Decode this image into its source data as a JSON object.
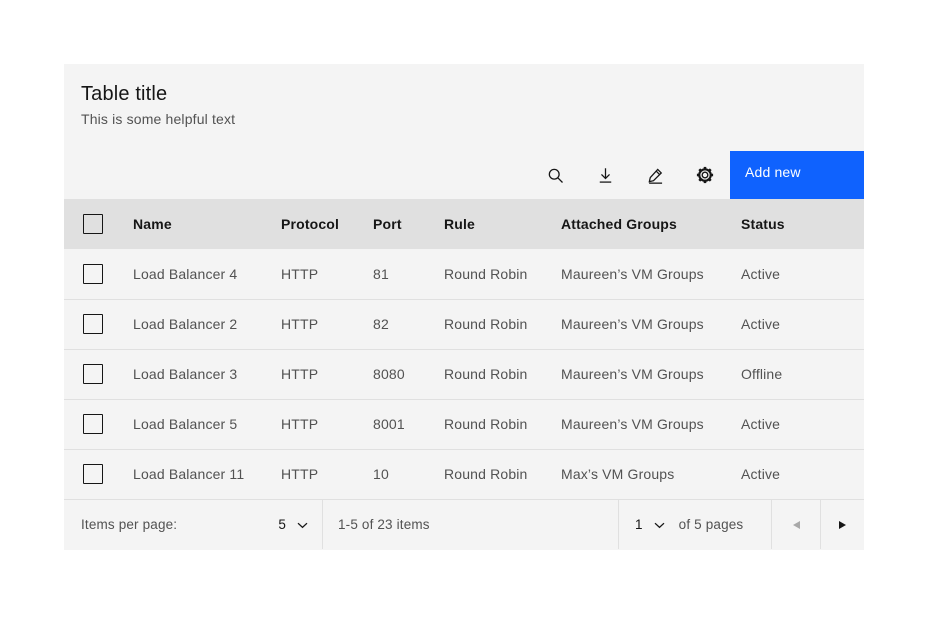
{
  "table": {
    "title": "Table title",
    "helper": "This is some helpful text",
    "toolbar": {
      "icons": [
        "search",
        "download",
        "edit",
        "settings"
      ],
      "add_label": "Add new"
    },
    "columns": [
      "Name",
      "Protocol",
      "Port",
      "Rule",
      "Attached Groups",
      "Status"
    ],
    "rows": [
      {
        "name": "Load Balancer 4",
        "protocol": "HTTP",
        "port": "81",
        "rule": "Round Robin",
        "attached_groups": "Maureen’s VM Groups",
        "status": "Active"
      },
      {
        "name": "Load Balancer 2",
        "protocol": "HTTP",
        "port": "82",
        "rule": "Round Robin",
        "attached_groups": "Maureen’s VM Groups",
        "status": "Active"
      },
      {
        "name": "Load Balancer 3",
        "protocol": "HTTP",
        "port": "8080",
        "rule": "Round Robin",
        "attached_groups": "Maureen’s VM Groups",
        "status": "Offline"
      },
      {
        "name": "Load Balancer 5",
        "protocol": "HTTP",
        "port": "8001",
        "rule": "Round Robin",
        "attached_groups": "Maureen’s VM Groups",
        "status": "Active"
      },
      {
        "name": "Load Balancer 11",
        "protocol": "HTTP",
        "port": "10",
        "rule": "Round Robin",
        "attached_groups": "Max’s VM Groups",
        "status": "Active"
      }
    ],
    "pagination": {
      "items_per_page_label": "Items per page:",
      "items_per_page_value": "5",
      "range_text": "1-5 of 23 items",
      "page_value": "1",
      "pages_label": "of 5 pages"
    }
  },
  "colors": {
    "accent": "#0f62fe",
    "container_bg": "#f4f4f4",
    "header_row_bg": "#e0e0e0",
    "text_primary": "#161616",
    "text_secondary": "#525252",
    "border_subtle": "#e0e0e0",
    "disabled_icon": "#a8a8a8"
  }
}
